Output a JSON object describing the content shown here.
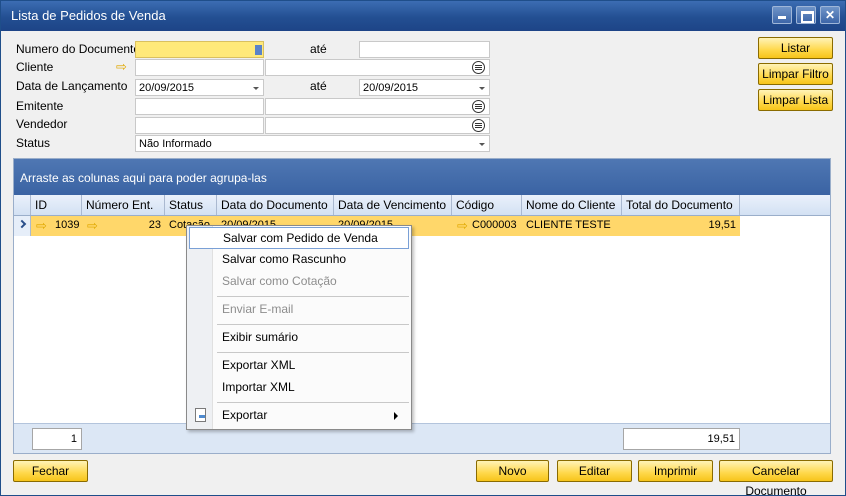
{
  "window": {
    "title": "Lista de Pedidos de Venda"
  },
  "form": {
    "numero_documento_label": "Numero do Documento",
    "ate_label_1": "até",
    "cliente_label": "Cliente",
    "data_lancamento_label": "Data de Lançamento",
    "data_lancamento_de": "20/09/2015",
    "ate_label_2": "até",
    "data_lancamento_ate": "20/09/2015",
    "emitente_label": "Emitente",
    "vendedor_label": "Vendedor",
    "status_label": "Status",
    "status_value": "Não Informado"
  },
  "side_buttons": {
    "listar": "Listar",
    "limpar_filtro": "Limpar Filtro",
    "limpar_lista": "Limpar Lista"
  },
  "grid": {
    "group_hint": "Arraste as colunas aqui para poder agrupa-las",
    "columns": [
      "ID",
      "Número Ent.",
      "Status",
      "Data do Documento",
      "Data de Vencimento",
      "Código",
      "Nome do Cliente",
      "Total do Documento"
    ],
    "row": {
      "id": "1039",
      "numero_ent": "23",
      "status": "Cotação",
      "data_documento": "20/09/2015",
      "data_vencimento": "20/09/2015",
      "codigo": "C000003",
      "nome_cliente": "CLIENTE TESTE",
      "total": "19,51"
    },
    "footer_count": "1",
    "footer_total": "19,51"
  },
  "context_menu": {
    "items": [
      {
        "label": "Salvar com Pedido de Venda",
        "enabled": true,
        "selected": true
      },
      {
        "label": "Salvar como Rascunho",
        "enabled": true
      },
      {
        "label": "Salvar como Cotação",
        "enabled": false
      },
      {
        "label": "Enviar E-mail",
        "enabled": false
      },
      {
        "label": "Exibir sumário",
        "enabled": true
      },
      {
        "label": "Exportar XML",
        "enabled": true
      },
      {
        "label": "Importar XML",
        "enabled": true
      },
      {
        "label": "Exportar",
        "enabled": true,
        "submenu": true
      }
    ]
  },
  "bottom_buttons": {
    "fechar": "Fechar",
    "novo": "Novo",
    "editar": "Editar",
    "imprimir": "Imprimir",
    "cancelar_documento": "Cancelar Documento"
  }
}
